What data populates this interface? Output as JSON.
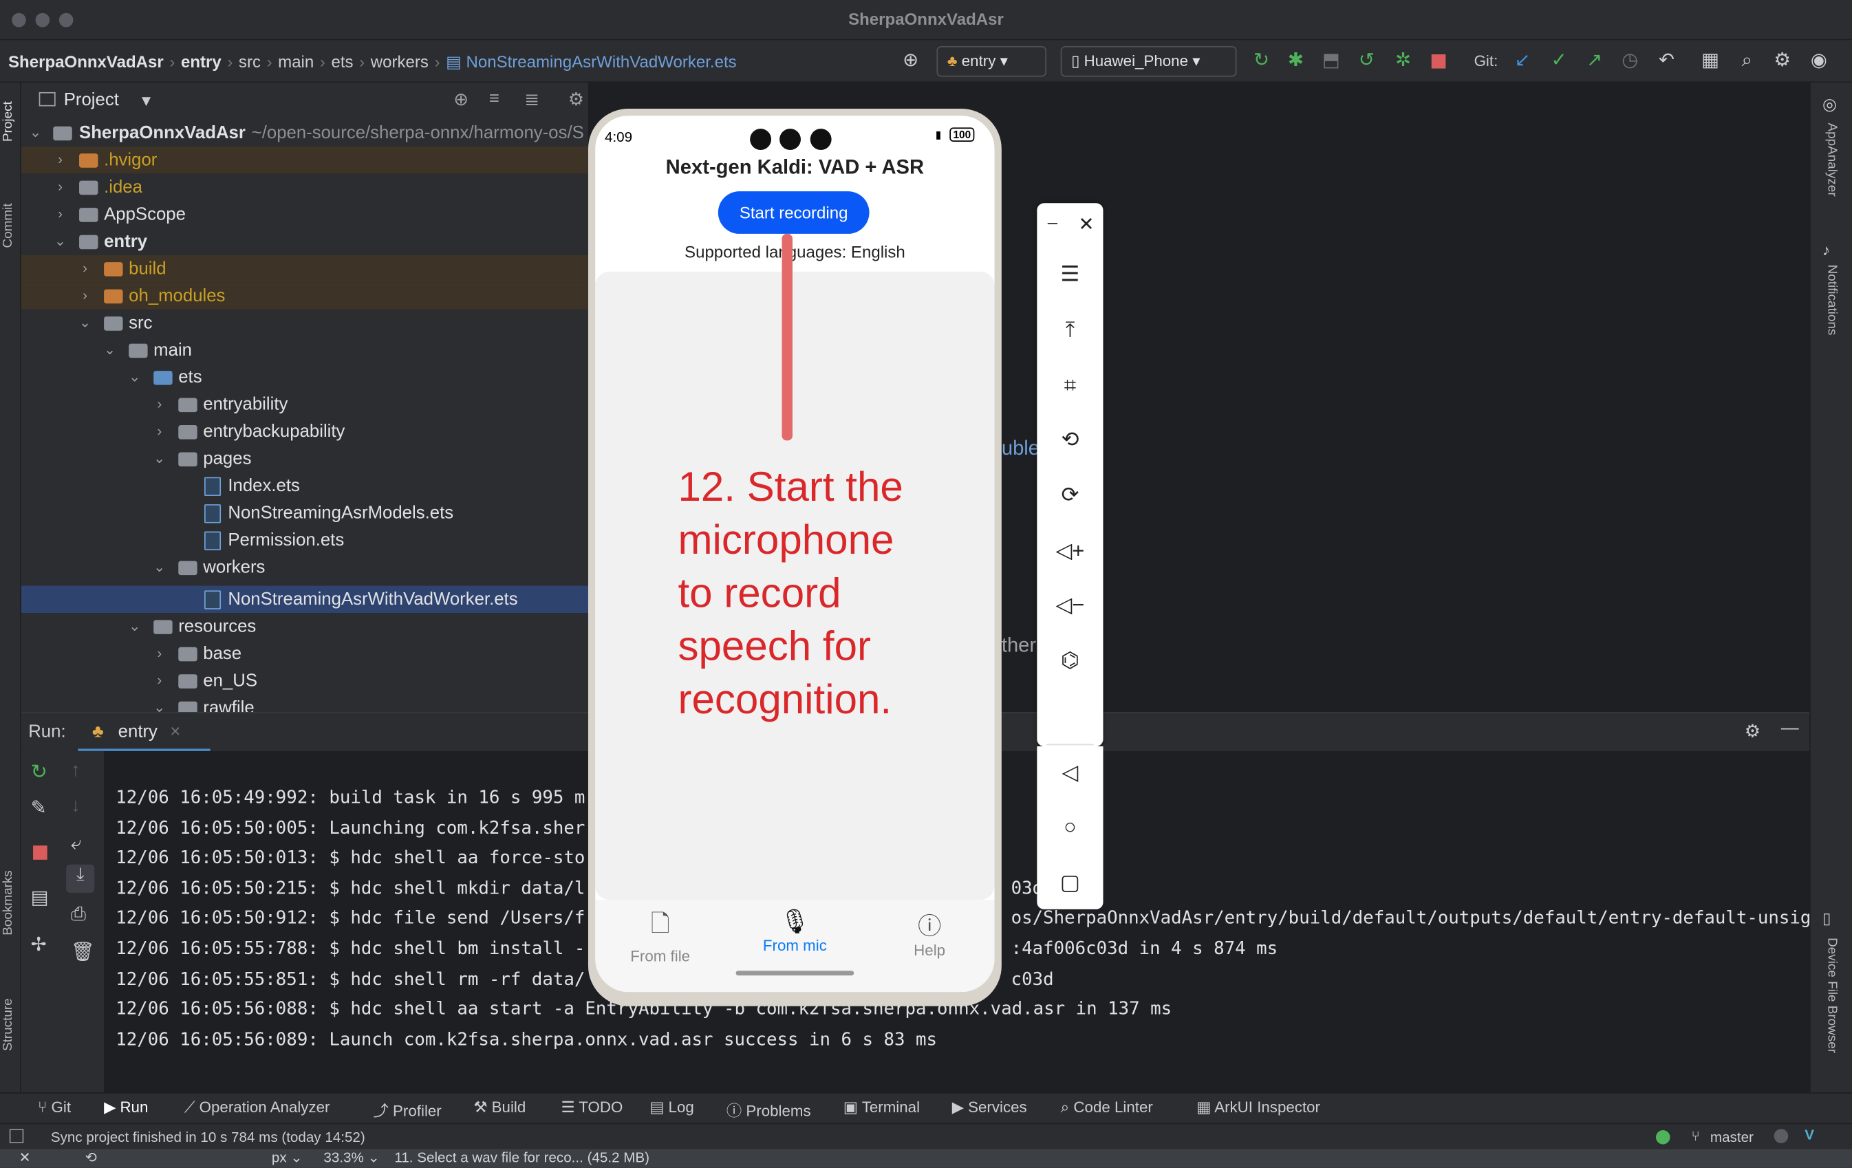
{
  "window": {
    "title": "SherpaOnnxVadAsr"
  },
  "breadcrumb": [
    "SherpaOnnxVadAsr",
    "entry",
    "src",
    "main",
    "ets",
    "workers",
    "NonStreamingAsrWithVadWorker.ets"
  ],
  "toolbar": {
    "run_config": "entry",
    "device": "Huawei_Phone",
    "git_label": "Git:"
  },
  "project": {
    "header": "Project",
    "root_name": "SherpaOnnxVadAsr",
    "root_path": "~/open-source/sherpa-onnx/harmony-os/S",
    "items": [
      {
        "label": ".hvigor"
      },
      {
        "label": ".idea"
      },
      {
        "label": "AppScope"
      },
      {
        "label": "entry"
      },
      {
        "label": "build"
      },
      {
        "label": "oh_modules"
      },
      {
        "label": "src"
      },
      {
        "label": "main"
      },
      {
        "label": "ets"
      },
      {
        "label": "entryability"
      },
      {
        "label": "entrybackupability"
      },
      {
        "label": "pages"
      },
      {
        "label": "Index.ets"
      },
      {
        "label": "NonStreamingAsrModels.ets"
      },
      {
        "label": "Permission.ets"
      },
      {
        "label": "workers"
      },
      {
        "label": "NonStreamingAsrWithVadWorker.ets"
      },
      {
        "label": "resources"
      },
      {
        "label": "base"
      },
      {
        "label": "en_US"
      },
      {
        "label": "rawfile"
      }
    ]
  },
  "editor_fragments": {
    "a": "uble",
    "b": "ther"
  },
  "run": {
    "label": "Run:",
    "tab": "entry",
    "log": [
      "12/06 16:05:49:992: build task in 16 s 995 m",
      "12/06 16:05:50:005: Launching com.k2fsa.sher",
      "12/06 16:05:50:013: $ hdc shell aa force-sto",
      "12/06 16:05:50:215: $ hdc shell mkdir data/l",
      "12/06 16:05:50:912: $ hdc file send /Users/f",
      "12/06 16:05:55:788: $ hdc shell bm install -",
      "12/06 16:05:55:851: $ hdc shell rm -rf data/",
      "12/06 16:05:56:088: $ hdc shell aa start -a EntryAbility -b com.k2fsa.sherpa.onnx.vad.asr in 137 ms",
      "12/06 16:05:56:089: Launch com.k2fsa.sherpa.onnx.vad.asr success in 6 s 83 ms"
    ],
    "log_tails": [
      "",
      "",
      "",
      "03d",
      "os/SherpaOnnxVadAsr/entry/build/default/outputs/default/entry-default-unsig",
      ":4af006c03d  in 4 s 874 ms",
      "c03d",
      "",
      ""
    ]
  },
  "bottom_tabs": [
    "Git",
    "Run",
    "Operation Analyzer",
    "Profiler",
    "Build",
    "TODO",
    "Log",
    "Problems",
    "Terminal",
    "Services",
    "Code Linter",
    "ArkUI Inspector"
  ],
  "status": {
    "message": "Sync project finished in 10 s 784 ms (today 14:52)",
    "branch": "master"
  },
  "dock": {
    "zoom": "33.3%",
    "unit": "px",
    "file": "11. Select a wav file for reco... (45.2 MB)"
  },
  "side_tabs": {
    "left": [
      "Project",
      "Commit",
      "Bookmarks",
      "Structure"
    ],
    "right": [
      "AppAnalyzer",
      "Notifications",
      "Device File Browser"
    ]
  },
  "phone": {
    "time": "4:09",
    "battery": "100",
    "app_title": "Next-gen Kaldi: VAD + ASR",
    "start_button": "Start recording",
    "languages": "Supported languages: English",
    "tabs": [
      {
        "label": "From file",
        "active": false
      },
      {
        "label": "From mic",
        "active": true
      },
      {
        "label": "Help",
        "active": false
      }
    ],
    "accent": "#0a59f7"
  },
  "annotation": {
    "text": "12. Start the microphone to record speech for recognition.",
    "lines": [
      "12. Start the",
      "microphone",
      "to record",
      "speech for",
      "recognition."
    ],
    "color": "#d9272a"
  },
  "emulator_toolbar": {
    "icons": [
      "minimize-icon",
      "close-icon",
      "menu-icon",
      "pin-top-icon",
      "crop-icon",
      "rotate-left-icon",
      "rotate-right-icon",
      "volume-up-icon",
      "volume-down-icon",
      "shake-icon",
      "back-icon",
      "home-icon",
      "recents-icon"
    ]
  }
}
